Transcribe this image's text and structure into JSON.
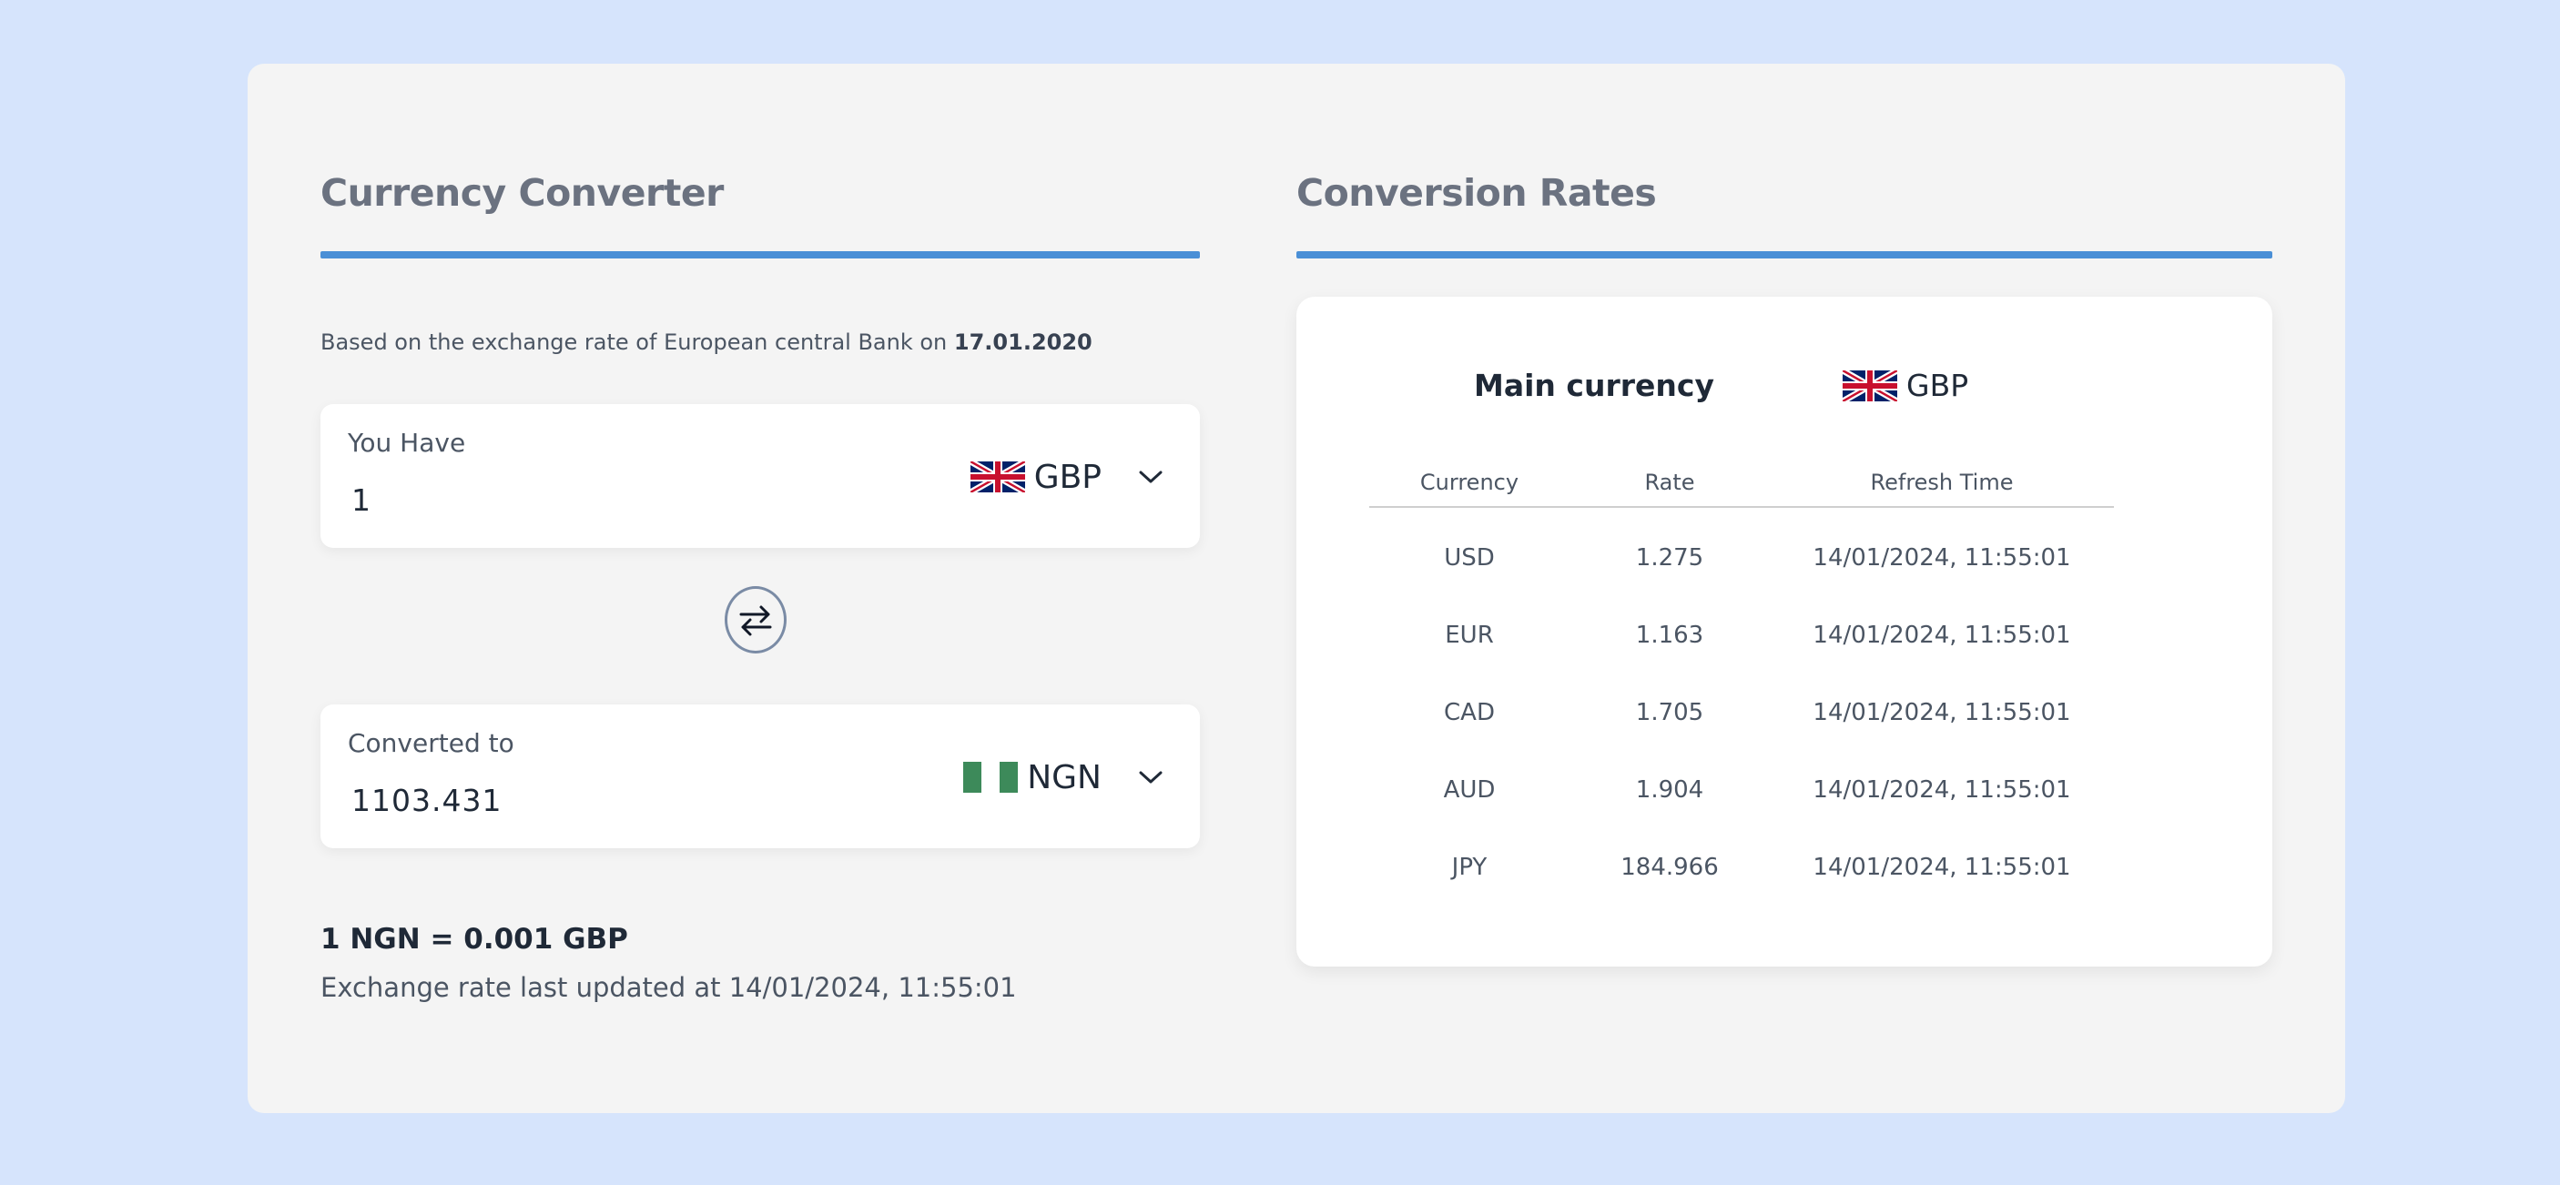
{
  "converter": {
    "title": "Currency Converter",
    "based_on_text": "Based on the exchange rate of European central Bank on ",
    "based_on_date": "17.01.2020",
    "from": {
      "label": "You Have",
      "amount": "1",
      "currency": "GBP",
      "flag": "uk-flag"
    },
    "to": {
      "label": "Converted to",
      "amount": "1103.431",
      "currency": "NGN",
      "flag": "nigeria-flag"
    },
    "rate_line": "1 NGN = 0.001 GBP",
    "updated_line": "Exchange rate last updated at 14/01/2024, 11:55:01"
  },
  "rates": {
    "title": "Conversion Rates",
    "main_label": "Main currency",
    "main_currency": "GBP",
    "columns": [
      "Currency",
      "Rate",
      "Refresh Time"
    ],
    "rows": [
      {
        "currency": "USD",
        "rate": "1.275",
        "time": "14/01/2024, 11:55:01"
      },
      {
        "currency": "EUR",
        "rate": "1.163",
        "time": "14/01/2024, 11:55:01"
      },
      {
        "currency": "CAD",
        "rate": "1.705",
        "time": "14/01/2024, 11:55:01"
      },
      {
        "currency": "AUD",
        "rate": "1.904",
        "time": "14/01/2024, 11:55:01"
      },
      {
        "currency": "JPY",
        "rate": "184.966",
        "time": "14/01/2024, 11:55:01"
      }
    ]
  },
  "colors": {
    "page_bg": "#d6e4fc",
    "card_bg": "#f4f4f4",
    "accent": "#4a8fd6",
    "nigeria_green": "#3d8a5a"
  }
}
